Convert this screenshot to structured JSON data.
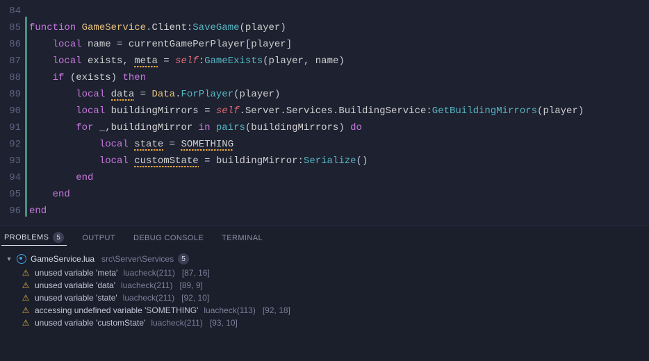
{
  "editor": {
    "lines": [
      {
        "num": "84",
        "mod": false,
        "tokens": []
      },
      {
        "num": "85",
        "mod": true,
        "tokens": [
          {
            "t": "function ",
            "c": "tok-kw"
          },
          {
            "t": "GameService",
            "c": "tok-fn"
          },
          {
            "t": ".",
            "c": "tok-op"
          },
          {
            "t": "Client",
            "c": "tok-ident"
          },
          {
            "t": ":",
            "c": "tok-op"
          },
          {
            "t": "SaveGame",
            "c": "tok-call"
          },
          {
            "t": "(",
            "c": "tok-paren"
          },
          {
            "t": "player",
            "c": "tok-param"
          },
          {
            "t": ")",
            "c": "tok-paren"
          }
        ]
      },
      {
        "num": "86",
        "mod": true,
        "tokens": [
          {
            "t": "    ",
            "c": ""
          },
          {
            "t": "local ",
            "c": "tok-kw"
          },
          {
            "t": "name",
            "c": "tok-ident"
          },
          {
            "t": " = ",
            "c": "tok-op"
          },
          {
            "t": "currentGamePerPlayer",
            "c": "tok-ident"
          },
          {
            "t": "[",
            "c": "tok-paren"
          },
          {
            "t": "player",
            "c": "tok-ident"
          },
          {
            "t": "]",
            "c": "tok-paren"
          }
        ]
      },
      {
        "num": "87",
        "mod": true,
        "tokens": [
          {
            "t": "    ",
            "c": ""
          },
          {
            "t": "local ",
            "c": "tok-kw"
          },
          {
            "t": "exists",
            "c": "tok-ident"
          },
          {
            "t": ", ",
            "c": "tok-op"
          },
          {
            "t": "meta",
            "c": "tok-ident",
            "u": true
          },
          {
            "t": " = ",
            "c": "tok-op"
          },
          {
            "t": "self",
            "c": "tok-self"
          },
          {
            "t": ":",
            "c": "tok-op"
          },
          {
            "t": "GameExists",
            "c": "tok-call"
          },
          {
            "t": "(",
            "c": "tok-paren"
          },
          {
            "t": "player",
            "c": "tok-ident"
          },
          {
            "t": ", ",
            "c": "tok-op"
          },
          {
            "t": "name",
            "c": "tok-ident"
          },
          {
            "t": ")",
            "c": "tok-paren"
          }
        ]
      },
      {
        "num": "88",
        "mod": true,
        "tokens": [
          {
            "t": "    ",
            "c": ""
          },
          {
            "t": "if ",
            "c": "tok-kw"
          },
          {
            "t": "(",
            "c": "tok-paren"
          },
          {
            "t": "exists",
            "c": "tok-ident"
          },
          {
            "t": ") ",
            "c": "tok-paren"
          },
          {
            "t": "then",
            "c": "tok-kw"
          }
        ]
      },
      {
        "num": "89",
        "mod": true,
        "tokens": [
          {
            "t": "        ",
            "c": ""
          },
          {
            "t": "local ",
            "c": "tok-kw"
          },
          {
            "t": "data",
            "c": "tok-ident",
            "u": true
          },
          {
            "t": " = ",
            "c": "tok-op"
          },
          {
            "t": "Data",
            "c": "tok-fn"
          },
          {
            "t": ".",
            "c": "tok-op"
          },
          {
            "t": "ForPlayer",
            "c": "tok-call"
          },
          {
            "t": "(",
            "c": "tok-paren"
          },
          {
            "t": "player",
            "c": "tok-ident"
          },
          {
            "t": ")",
            "c": "tok-paren"
          }
        ]
      },
      {
        "num": "90",
        "mod": true,
        "tokens": [
          {
            "t": "        ",
            "c": ""
          },
          {
            "t": "local ",
            "c": "tok-kw"
          },
          {
            "t": "buildingMirrors",
            "c": "tok-ident"
          },
          {
            "t": " = ",
            "c": "tok-op"
          },
          {
            "t": "self",
            "c": "tok-self"
          },
          {
            "t": ".",
            "c": "tok-op"
          },
          {
            "t": "Server",
            "c": "tok-ident"
          },
          {
            "t": ".",
            "c": "tok-op"
          },
          {
            "t": "Services",
            "c": "tok-ident"
          },
          {
            "t": ".",
            "c": "tok-op"
          },
          {
            "t": "BuildingService",
            "c": "tok-ident"
          },
          {
            "t": ":",
            "c": "tok-op"
          },
          {
            "t": "GetBuildingMirrors",
            "c": "tok-call"
          },
          {
            "t": "(",
            "c": "tok-paren"
          },
          {
            "t": "player",
            "c": "tok-ident"
          },
          {
            "t": ")",
            "c": "tok-paren"
          }
        ]
      },
      {
        "num": "91",
        "mod": true,
        "tokens": [
          {
            "t": "        ",
            "c": ""
          },
          {
            "t": "for ",
            "c": "tok-kw"
          },
          {
            "t": "_",
            "c": "tok-ident"
          },
          {
            "t": ",",
            "c": "tok-op"
          },
          {
            "t": "buildingMirror",
            "c": "tok-ident"
          },
          {
            "t": " in ",
            "c": "tok-kw"
          },
          {
            "t": "pairs",
            "c": "tok-call"
          },
          {
            "t": "(",
            "c": "tok-paren"
          },
          {
            "t": "buildingMirrors",
            "c": "tok-ident"
          },
          {
            "t": ") ",
            "c": "tok-paren"
          },
          {
            "t": "do",
            "c": "tok-kw"
          }
        ]
      },
      {
        "num": "92",
        "mod": true,
        "tokens": [
          {
            "t": "            ",
            "c": ""
          },
          {
            "t": "local ",
            "c": "tok-kw"
          },
          {
            "t": "state",
            "c": "tok-ident",
            "u": true
          },
          {
            "t": " = ",
            "c": "tok-op"
          },
          {
            "t": "SOMETHING",
            "c": "tok-ident",
            "u": true
          }
        ]
      },
      {
        "num": "93",
        "mod": true,
        "tokens": [
          {
            "t": "            ",
            "c": ""
          },
          {
            "t": "local ",
            "c": "tok-kw"
          },
          {
            "t": "customState",
            "c": "tok-ident",
            "u": true
          },
          {
            "t": " = ",
            "c": "tok-op"
          },
          {
            "t": "buildingMirror",
            "c": "tok-ident"
          },
          {
            "t": ":",
            "c": "tok-op"
          },
          {
            "t": "Serialize",
            "c": "tok-call"
          },
          {
            "t": "()",
            "c": "tok-paren"
          }
        ]
      },
      {
        "num": "94",
        "mod": true,
        "tokens": [
          {
            "t": "        ",
            "c": ""
          },
          {
            "t": "end",
            "c": "tok-kw"
          }
        ]
      },
      {
        "num": "95",
        "mod": true,
        "tokens": [
          {
            "t": "    ",
            "c": ""
          },
          {
            "t": "end",
            "c": "tok-kw"
          }
        ]
      },
      {
        "num": "96",
        "mod": true,
        "tokens": [
          {
            "t": "end",
            "c": "tok-kw"
          }
        ]
      }
    ]
  },
  "panel": {
    "tabs": {
      "problems": "PROBLEMS",
      "problems_count": "5",
      "output": "OUTPUT",
      "debug": "DEBUG CONSOLE",
      "terminal": "TERMINAL"
    },
    "file": {
      "name": "GameService.lua",
      "path": "src\\Server\\Services",
      "count": "5"
    },
    "issues": [
      {
        "msg": "unused variable 'meta'",
        "src": "luacheck(211)",
        "loc": "[87, 16]"
      },
      {
        "msg": "unused variable 'data'",
        "src": "luacheck(211)",
        "loc": "[89, 9]"
      },
      {
        "msg": "unused variable 'state'",
        "src": "luacheck(211)",
        "loc": "[92, 10]"
      },
      {
        "msg": "accessing undefined variable 'SOMETHING'",
        "src": "luacheck(113)",
        "loc": "[92, 18]"
      },
      {
        "msg": "unused variable 'customState'",
        "src": "luacheck(211)",
        "loc": "[93, 10]"
      }
    ]
  }
}
